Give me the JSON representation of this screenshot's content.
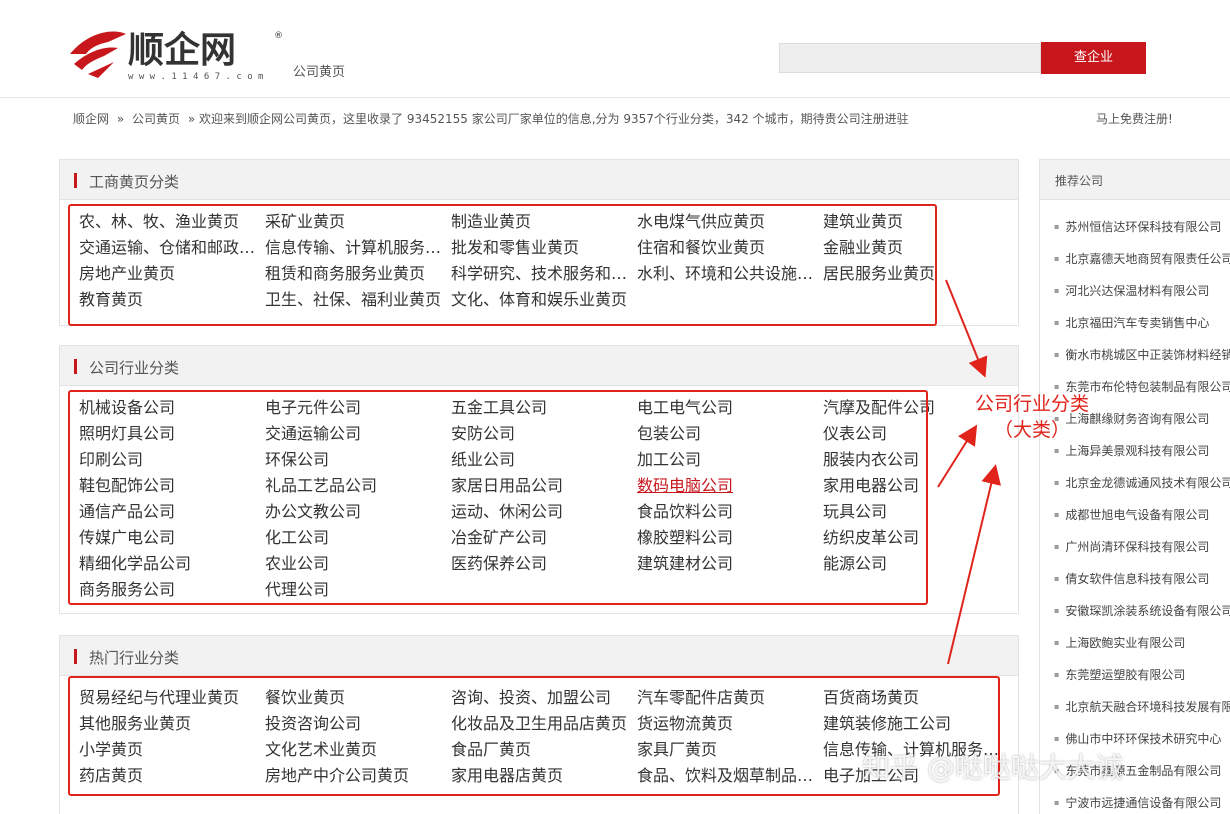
{
  "header": {
    "logo_text": "顺企网",
    "logo_url_text": "w w w . 1 1 4 6 7 . c o m",
    "logo_sub": "公司黄页",
    "search_placeholder": "",
    "search_button": "查企业"
  },
  "breadcrumb": {
    "home": "顺企网",
    "sep": "»",
    "current": "公司黄页",
    "intro": "» 欢迎来到顺企网公司黄页，这里收录了 93452155 家公司厂家单位的信息,分为 9357个行业分类，342 个城市，期待贵公司注册进驻",
    "register": "马上免费注册!"
  },
  "sections": [
    {
      "title": "工商黄页分类",
      "items": [
        "农、林、牧、渔业黄页",
        "采矿业黄页",
        "制造业黄页",
        "水电煤气供应黄页",
        "建筑业黄页",
        "交通运输、仓储和邮政业黄页",
        "信息传输、计算机服务和软件业黄页",
        "批发和零售业黄页",
        "住宿和餐饮业黄页",
        "金融业黄页",
        "房地产业黄页",
        "租赁和商务服务业黄页",
        "科学研究、技术服务和地质勘查业黄页",
        "水利、环境和公共设施管理业黄页",
        "居民服务业黄页",
        "教育黄页",
        "卫生、社保、福利业黄页",
        "文化、体育和娱乐业黄页"
      ]
    },
    {
      "title": "公司行业分类",
      "items": [
        "机械设备公司",
        "电子元件公司",
        "五金工具公司",
        "电工电气公司",
        "汽摩及配件公司",
        "照明灯具公司",
        "交通运输公司",
        "安防公司",
        "包装公司",
        "仪表公司",
        "印刷公司",
        "环保公司",
        "纸业公司",
        "加工公司",
        "服装内衣公司",
        "鞋包配饰公司",
        "礼品工艺品公司",
        "家居日用品公司",
        "数码电脑公司",
        "家用电器公司",
        "通信产品公司",
        "办公文教公司",
        "运动、休闲公司",
        "食品饮料公司",
        "玩具公司",
        "传媒广电公司",
        "化工公司",
        "冶金矿产公司",
        "橡胶塑料公司",
        "纺织皮革公司",
        "精细化学品公司",
        "农业公司",
        "医药保养公司",
        "建筑建材公司",
        "能源公司",
        "商务服务公司",
        "代理公司"
      ]
    },
    {
      "title": "热门行业分类",
      "items": [
        "贸易经纪与代理业黄页",
        "餐饮业黄页",
        "咨询、投资、加盟公司",
        "汽车零配件店黄页",
        "百货商场黄页",
        "其他服务业黄页",
        "投资咨询公司",
        "化妆品及卫生用品店黄页",
        "货运物流黄页",
        "建筑装修施工公司",
        "小学黄页",
        "文化艺术业黄页",
        "食品厂黄页",
        "家具厂黄页",
        "信息传输、计算机服务和软件业黄页",
        "药店黄页",
        "房地产中介公司黄页",
        "家用电器店黄页",
        "食品、饮料及烟草制品批发黄页",
        "电子加工公司"
      ]
    }
  ],
  "sidebar": {
    "title": "推荐公司",
    "items": [
      "苏州恒信达环保科技有限公司",
      "北京嘉德天地商贸有限责任公司",
      "河北兴达保温材料有限公司",
      "北京福田汽车专卖销售中心",
      "衡水市桃城区中正装饰材料经销部",
      "东莞市布伦特包装制品有限公司",
      "上海麒缘财务咨询有限公司",
      "上海异美景观科技有限公司",
      "北京金龙德诚通风技术有限公司",
      "成都世旭电气设备有限公司",
      "广州尚清环保科技有限公司",
      "倩女软件信息科技有限公司",
      "安徽琛凯涂装系统设备有限公司",
      "上海欧鲍实业有限公司",
      "东莞塑运塑胶有限公司",
      "北京航天融合环境科技发展有限公司",
      "佛山市中环环保技术研究中心",
      "东莞市鑫源五金制品有限公司",
      "宁波市远捷通信设备有限公司"
    ]
  },
  "annotation": {
    "line1": "公司行业分类",
    "line2": "（大类）"
  },
  "watermark": "知乎 @哒哒哒大大诚",
  "colors": {
    "accent": "#c8161d",
    "annotation": "#e0241b"
  }
}
